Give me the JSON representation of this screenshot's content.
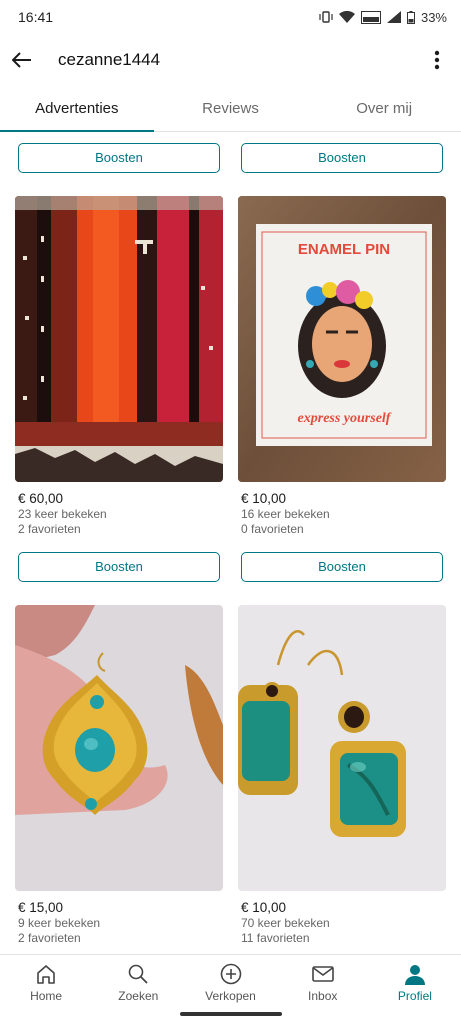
{
  "status_bar": {
    "time": "16:41",
    "battery": "33%",
    "network": "LTE"
  },
  "header": {
    "title": "cezanne1444"
  },
  "tabs": [
    {
      "label": "Advertenties",
      "active": true
    },
    {
      "label": "Reviews",
      "active": false
    },
    {
      "label": "Over mij",
      "active": false
    }
  ],
  "boost_label": "Boosten",
  "listings": [
    {
      "price": "€ 60,00",
      "views": "23 keer bekeken",
      "favorites": "2 favorieten",
      "image": "striped red and black kilim fabric"
    },
    {
      "price": "€ 10,00",
      "views": "16 keer bekeken",
      "favorites": "0 favorieten",
      "image": "Frida enamel pin card",
      "pin_title": "ENAMEL PIN",
      "pin_caption": "express yourself"
    },
    {
      "price": "€ 15,00",
      "views": "9 keer bekeken",
      "favorites": "2 favorieten",
      "image": "gold earring with turquoise stones"
    },
    {
      "price": "€ 10,00",
      "views": "70 keer bekeken",
      "favorites": "11 favorieten",
      "image": "gold earrings with turquoise stones"
    }
  ],
  "bottom_nav": [
    {
      "label": "Home",
      "icon": "home-icon",
      "active": false
    },
    {
      "label": "Zoeken",
      "icon": "search-icon",
      "active": false
    },
    {
      "label": "Verkopen",
      "icon": "plus-circle-icon",
      "active": false
    },
    {
      "label": "Inbox",
      "icon": "mail-icon",
      "active": false
    },
    {
      "label": "Profiel",
      "icon": "person-icon",
      "active": true
    }
  ],
  "colors": {
    "accent": "#007782",
    "text": "#1b1b1b",
    "muted": "#666666"
  }
}
